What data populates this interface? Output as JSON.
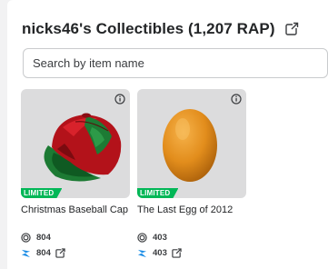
{
  "header": {
    "title": "nicks46's Collectibles (1,207 RAP)",
    "link_icon": "external-link-icon"
  },
  "search": {
    "placeholder": "Search by item name",
    "value": ""
  },
  "colors": {
    "limited_badge": "#02b757",
    "card_bg": "#dcdcdd",
    "robux_blue": "#1e8ee6"
  },
  "items": [
    {
      "name": "Christmas Baseball Cap",
      "badge": "LIMITED",
      "rap": "804",
      "value": "804",
      "rap_icon": "recent-average-price-icon",
      "value_icon": "rolimons-icon"
    },
    {
      "name": "The Last Egg of 2012",
      "badge": "LIMITED",
      "rap": "403",
      "value": "403",
      "rap_icon": "recent-average-price-icon",
      "value_icon": "rolimons-icon"
    }
  ]
}
